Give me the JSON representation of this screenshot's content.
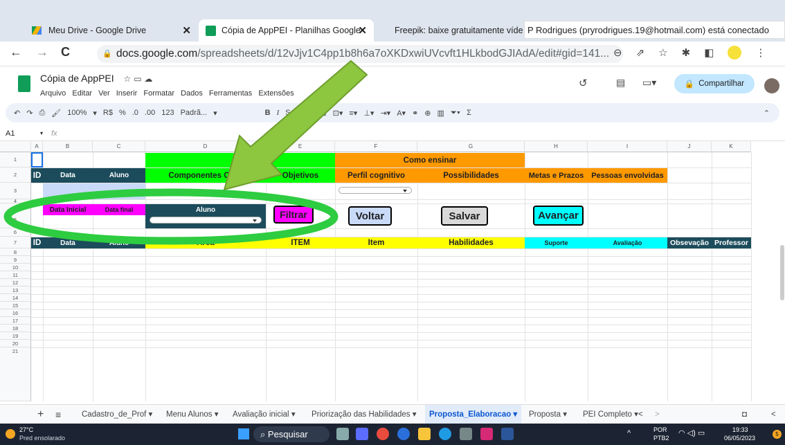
{
  "browser": {
    "tabs": [
      {
        "title": "Meu Drive - Google Drive",
        "close": "✕"
      },
      {
        "title": "Cópia de AppPEI - Planilhas Google",
        "close": "✕"
      },
      {
        "title": "Freepik: baixe gratuitamente víde",
        "close": ""
      }
    ],
    "notification": "P Rodrigues (pryrodrigues.19@hotmail.com) está conectado",
    "url_domain": "docs.google.com",
    "url_path": "/spreadsheets/d/12vJjv1C4pp1b8h6a7oXKDxwiUVcvft1HLkbodGJIAdA/edit#gid=141...",
    "nav": {
      "back": "←",
      "forward": "→",
      "reload": "C"
    }
  },
  "doc": {
    "title": "Cópia de AppPEI",
    "menus": [
      "Arquivo",
      "Editar",
      "Ver",
      "Inserir",
      "Formatar",
      "Dados",
      "Ferramentas",
      "Extensões"
    ],
    "share_label": "Compartilhar",
    "toolbar": {
      "zoom": "100%",
      "currency": "R$",
      "percent": "%",
      "dec_less": ".0",
      "dec_more": ".00",
      "format123": "123",
      "font": "Padrã...",
      "bold": "B",
      "italic": "I",
      "sigma": "Σ"
    },
    "cell_ref": "A1",
    "fx": "fx"
  },
  "grid": {
    "columns": [
      "A",
      "B",
      "C",
      "D",
      "E",
      "F",
      "G",
      "H",
      "I",
      "J",
      "K"
    ],
    "rows": [
      "1",
      "2",
      "3",
      "4",
      "5",
      "6",
      "7",
      "8",
      "9",
      "10",
      "11",
      "12",
      "13",
      "14",
      "15",
      "16",
      "17",
      "18",
      "19",
      "20",
      "21"
    ],
    "row1": {
      "o_que": "O q",
      "como_ensinar": "Como ensinar"
    },
    "row2": [
      "ID",
      "Data",
      "Aluno",
      "Componentes Curri",
      "Objetivos",
      "Perfil cognitivo",
      "Possibilidades",
      "Metas e Prazos",
      "Pessoas envolvidas"
    ],
    "row5": {
      "data_inicial": "Data Inicial",
      "data_final": "Data final",
      "aluno": "Aluno"
    },
    "buttons": {
      "filtrar": "Filtrar",
      "voltar": "Voltar",
      "salvar": "Salvar",
      "avancar": "Avançar"
    },
    "row7": [
      "ID",
      "Data",
      "Aluno",
      "Área",
      "ITEM",
      "Item",
      "Habilidades",
      "Suporte",
      "Avaliação",
      "Obsevação",
      "Professor"
    ]
  },
  "sheets": [
    "Cadastro_de_Prof",
    "Menu Alunos",
    "Avaliação inicial",
    "Priorização das Habilidades",
    "Proposta_Elaboracao",
    "Proposta",
    "PEI Completo"
  ],
  "active_sheet": "Proposta_Elaboracao",
  "taskbar": {
    "weather_temp": "27°C",
    "weather_desc": "Pred ensolarado",
    "search": "Pesquisar",
    "lang": "POR",
    "lang2": "PTB2",
    "time": "19:33",
    "date": "06/05/2023",
    "badge": "5"
  },
  "colors": {
    "green": "#00ff00",
    "orange": "#ff9900",
    "darkteal": "#1c4c5c",
    "magenta": "#ff00ff",
    "yellow": "#ffff00",
    "cyan": "#00ffff",
    "arrow": "#8dc63f",
    "ellipse": "#2ecc40"
  }
}
